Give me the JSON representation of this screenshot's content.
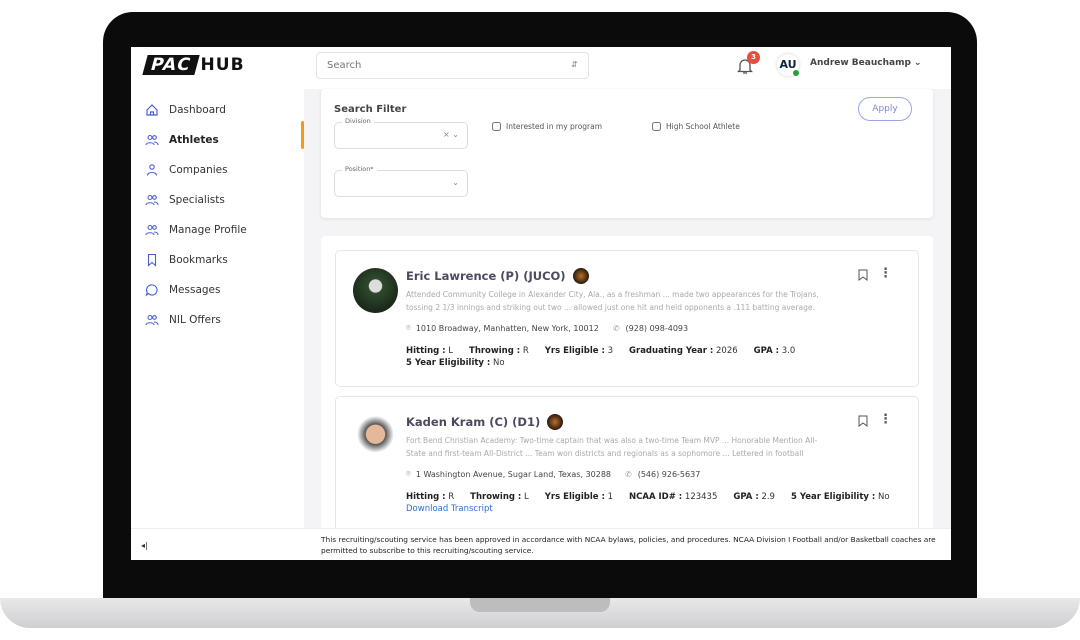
{
  "logo": {
    "left": "PAC",
    "right": "HUB"
  },
  "sidebar": {
    "items": [
      {
        "label": "Dashboard",
        "icon": "home-icon"
      },
      {
        "label": "Athletes",
        "icon": "users-icon",
        "active": true
      },
      {
        "label": "Companies",
        "icon": "user-icon"
      },
      {
        "label": "Specialists",
        "icon": "users-icon"
      },
      {
        "label": "Manage Profile",
        "icon": "users-icon"
      },
      {
        "label": "Bookmarks",
        "icon": "bookmark-icon"
      },
      {
        "label": "Messages",
        "icon": "message-icon"
      },
      {
        "label": "NIL Offers",
        "icon": "users-icon"
      }
    ],
    "accent": "#f39c12"
  },
  "header": {
    "search_placeholder": "Search",
    "notifications": "3",
    "user_initials": "AU",
    "user_name": "Andrew Beauchamp"
  },
  "filter": {
    "title": "Search Filter",
    "division_label": "Division",
    "position_label": "Position*",
    "interested": "Interested in my program",
    "high_school": "High School Athlete",
    "apply": "Apply"
  },
  "athletes": [
    {
      "name": "Eric Lawrence (P) (JUCO)",
      "bio": "Attended Community College in Alexander City, Ala., as a freshman ... made two appearances for the Trojans, tossing 2 1/3 innings and striking out two ... allowed just one hit and held opponents a .111 batting average.",
      "address": "1010 Broadway, Manhatten, New York, 10012",
      "phone": "(928) 098-4093",
      "stats": [
        {
          "k": "Hitting :",
          "v": "L"
        },
        {
          "k": "Throwing :",
          "v": "R"
        },
        {
          "k": "Yrs Eligible :",
          "v": "3"
        },
        {
          "k": "Graduating Year :",
          "v": "2026"
        },
        {
          "k": "GPA :",
          "v": "3.0"
        },
        {
          "k": "5 Year Eligibility :",
          "v": "No"
        }
      ]
    },
    {
      "name": "Kaden Kram (C) (D1)",
      "bio": "Fort Bend Christian Academy: Two-time captain that was also a two-time Team MVP ... Honorable Mention All-State and first-team All-District ... Team won districts and regionals as a sophomore ... Lettered in football",
      "address": "1 Washington Avenue, Sugar Land, Texas, 30288",
      "phone": "(546) 926-5637",
      "stats": [
        {
          "k": "Hitting :",
          "v": "R"
        },
        {
          "k": "Throwing :",
          "v": "L"
        },
        {
          "k": "Yrs Eligible :",
          "v": "1"
        },
        {
          "k": "NCAA ID# :",
          "v": "123435"
        },
        {
          "k": "GPA :",
          "v": "2.9"
        },
        {
          "k": "5 Year Eligibility :",
          "v": "No"
        }
      ],
      "link": "Download Transcript"
    }
  ],
  "footer": {
    "text": "This recruiting/scouting service has been approved in accordance with NCAA bylaws, policies, and procedures. NCAA Division I Football and/or Basketball coaches are permitted to subscribe to this recruiting/scouting service.",
    "collapse": "◂|"
  }
}
